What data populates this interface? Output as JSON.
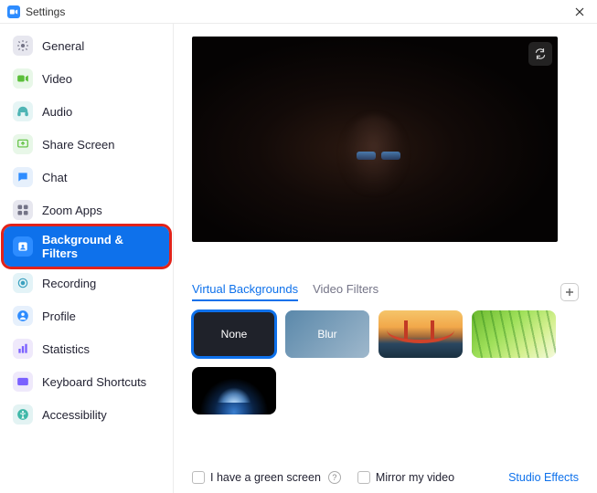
{
  "window": {
    "title": "Settings"
  },
  "sidebar": {
    "items": [
      {
        "label": "General"
      },
      {
        "label": "Video"
      },
      {
        "label": "Audio"
      },
      {
        "label": "Share Screen"
      },
      {
        "label": "Chat"
      },
      {
        "label": "Zoom Apps"
      },
      {
        "label": "Background & Filters"
      },
      {
        "label": "Recording"
      },
      {
        "label": "Profile"
      },
      {
        "label": "Statistics"
      },
      {
        "label": "Keyboard Shortcuts"
      },
      {
        "label": "Accessibility"
      }
    ]
  },
  "tabs": {
    "virtual_backgrounds": "Virtual Backgrounds",
    "video_filters": "Video Filters"
  },
  "thumbs": {
    "none": "None",
    "blur": "Blur"
  },
  "footer": {
    "green_screen": "I have a green screen",
    "mirror": "Mirror my video",
    "studio": "Studio Effects"
  }
}
